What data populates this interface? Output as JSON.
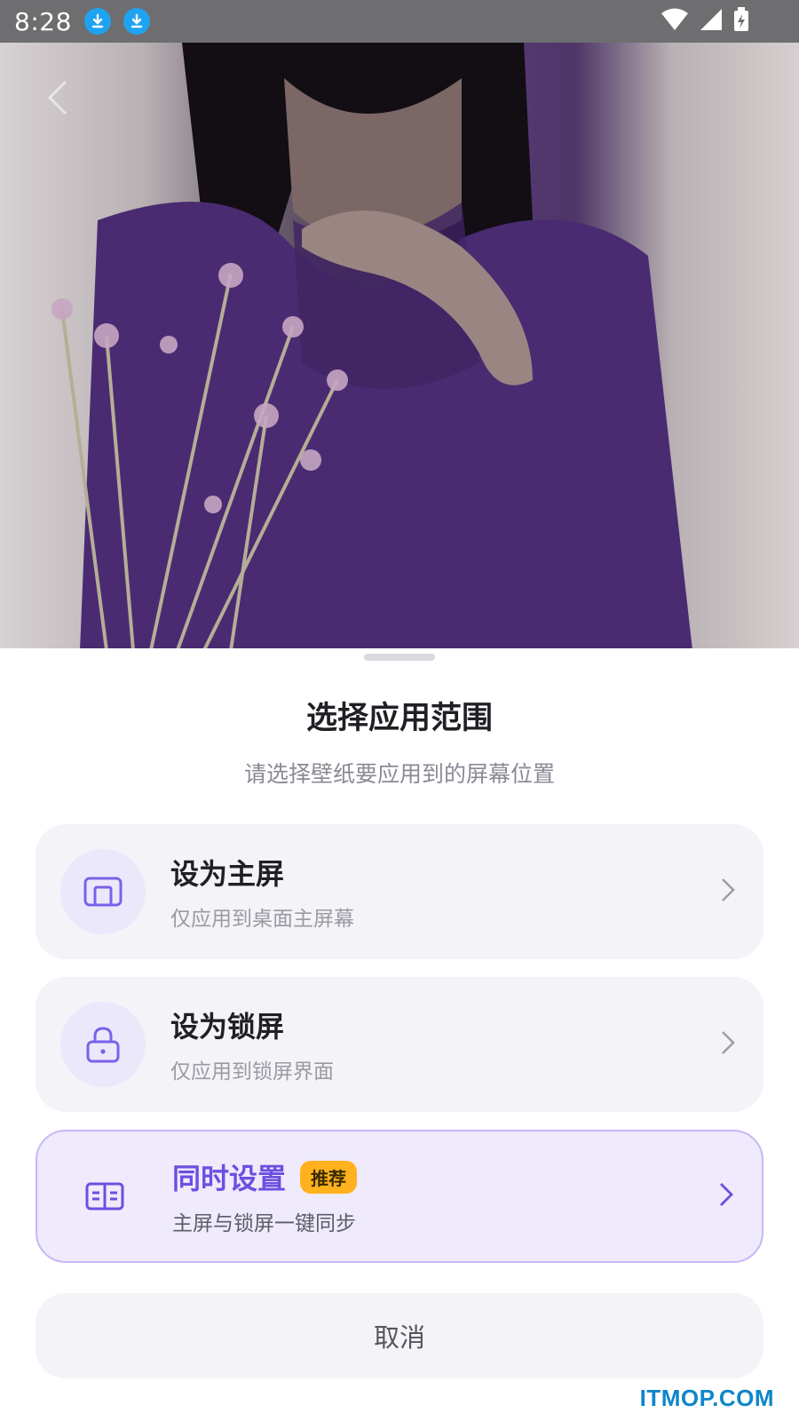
{
  "status_bar": {
    "time": "8:28",
    "icons": [
      "download-icon",
      "download-icon",
      "wifi-icon",
      "signal-icon",
      "battery-charging-icon"
    ]
  },
  "preview": {
    "back_icon": "chevron-left-icon"
  },
  "sheet": {
    "title": "选择应用范围",
    "subtitle": "请选择壁纸要应用到的屏幕位置",
    "options": [
      {
        "icon": "home-screen-icon",
        "title": "设为主屏",
        "desc": "仅应用到桌面主屏幕"
      },
      {
        "icon": "lock-icon",
        "title": "设为锁屏",
        "desc": "仅应用到锁屏界面"
      },
      {
        "icon": "dual-screen-icon",
        "title": "同时设置",
        "badge": "推荐",
        "desc": "主屏与锁屏一键同步"
      }
    ],
    "cancel_label": "取消"
  },
  "colors": {
    "accent": "#6c4fe0",
    "badge": "#ffb21e",
    "card_bg": "#f3f3f8",
    "highlight_bg": "#efeafc",
    "statusbar_bg": "#6e6e70"
  },
  "watermark": "ITMOP.COM"
}
